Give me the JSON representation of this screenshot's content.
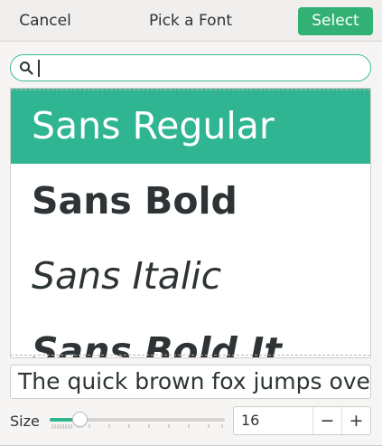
{
  "header": {
    "cancel_label": "Cancel",
    "title": "Pick a Font",
    "select_label": "Select"
  },
  "search": {
    "value": "",
    "icon": "search-icon"
  },
  "font_list": {
    "selected_index": 0,
    "items": [
      {
        "label": "Sans Regular"
      },
      {
        "label": "Sans Bold"
      },
      {
        "label": "Sans Italic"
      },
      {
        "label": "Sans Bold It"
      }
    ]
  },
  "preview": {
    "text": "The quick brown fox jumps over the lazy dog."
  },
  "size": {
    "label": "Size",
    "value": "16",
    "slider_fraction": 0.17,
    "minus_label": "−",
    "plus_label": "+"
  },
  "colors": {
    "accent": "#33b074",
    "selection": "#2fb592",
    "search_border": "#3dbd96"
  }
}
